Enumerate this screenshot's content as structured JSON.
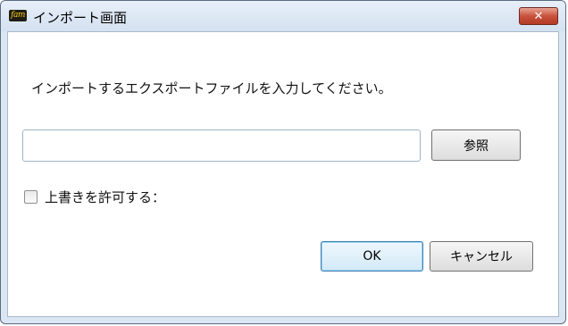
{
  "window": {
    "title": "インポート画面",
    "app_icon_text": "fam",
    "close_label": "✕"
  },
  "dialog": {
    "instruction": "インポートするエクスポートファイルを入力してください。",
    "file_input": {
      "value": "",
      "placeholder": ""
    },
    "browse_label": "参照",
    "overwrite_label": "上書きを許可する：",
    "overwrite_checked": false,
    "ok_label": "OK",
    "cancel_label": "キャンセル"
  },
  "colors": {
    "frame": "#dbe6f3",
    "close_button": "#c9523d",
    "ok_border": "#3c7fb1"
  }
}
